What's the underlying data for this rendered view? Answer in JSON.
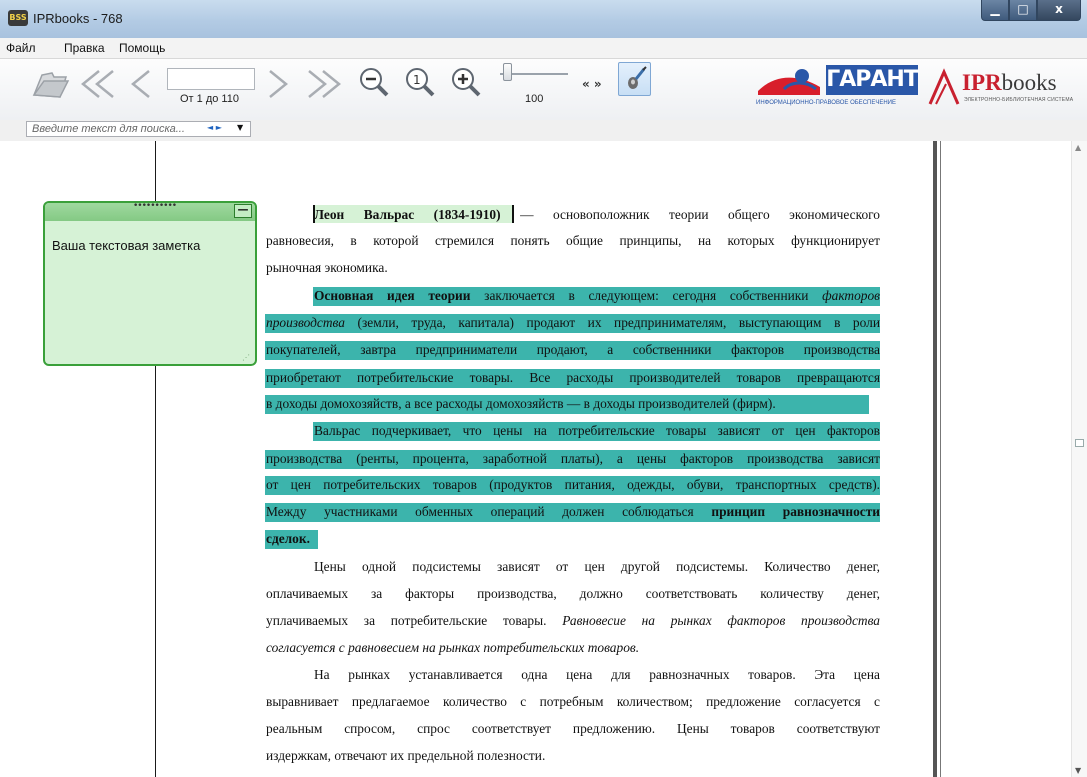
{
  "window": {
    "title": "IPRbooks - 768",
    "app_icon_text": "BSS",
    "controls": {
      "minimize": "▁",
      "maximize": "□",
      "close": "x"
    }
  },
  "menu": [
    "Файл",
    "Правка",
    "Помощь"
  ],
  "toolbar": {
    "open_icon": "folder-open-icon",
    "first_icon": "first-page-icon",
    "prev_icon": "previous-page-icon",
    "page_value": "",
    "page_caption": "От 1 до 110",
    "next_icon": "next-page-icon",
    "last_icon": "last-page-icon",
    "zoom_out_icon": "zoom-out-icon",
    "zoom_actual_icon": "zoom-actual-size-icon",
    "zoom_in_icon": "zoom-in-icon",
    "zoom_value": "100",
    "zoom_level": 0.05,
    "collapse_label": "« »",
    "note_tool_icon": "note-pen-icon"
  },
  "logos": {
    "garant_word": "ГАРАНТ",
    "garant_tag": "ИНФОРМАЦИОННО-ПРАВОВОЕ ОБЕСПЕЧЕНИЕ",
    "ipr_word": "IPR",
    "ipr_word_rest": "books",
    "ipr_tag": "ЭЛЕКТРОННО-БИБЛИОТЕЧНАЯ СИСТЕМА"
  },
  "search": {
    "placeholder": "Введите текст для поиска...",
    "nav": "◄ ►",
    "dropdown": "▼"
  },
  "note": {
    "grip": "••••••••••",
    "minimize": "—",
    "text": "Ваша текстовая заметка",
    "resize": "⋰"
  },
  "colors": {
    "highlight": "#3cb4ac",
    "note_bg": "#d6f2d6",
    "note_border": "#3aa03a"
  },
  "document": {
    "lines": [
      {
        "segs": [
          {
            "t": "Леон Вальрас (1834-1910)",
            "s": "b"
          },
          {
            "t": "  — основоположник теории общего экономического",
            "s": ""
          }
        ]
      },
      {
        "segs": [
          {
            "t": "равновесия, в которой стремился понять общие принципы, на которых функционирует",
            "s": ""
          }
        ]
      },
      {
        "segs": [
          {
            "t": "рыночная экономика.",
            "s": ""
          }
        ]
      },
      {
        "segs": [
          {
            "t": "Основная идея теории",
            "s": "b"
          },
          {
            "t": " заключается в следующем: сегодня собственники ",
            "s": ""
          },
          {
            "t": "факторов",
            "s": "i"
          }
        ]
      },
      {
        "segs": [
          {
            "t": "производства",
            "s": "i"
          },
          {
            "t": " (земли, труда, капитала) продают их предпринимателям, выступающим в роли",
            "s": ""
          }
        ]
      },
      {
        "segs": [
          {
            "t": "покупателей, завтра предприниматели продают, а собственники факторов производства",
            "s": ""
          }
        ]
      },
      {
        "segs": [
          {
            "t": "приобретают потребительские товары. Все расходы производителей товаров превращаются",
            "s": ""
          }
        ]
      },
      {
        "segs": [
          {
            "t": "в доходы домохозяйств, а все расходы домохозяйств — в доходы производителей (фирм).",
            "s": ""
          }
        ]
      },
      {
        "segs": [
          {
            "t": "Вальрас подчеркивает, что цены на потребительские товары зависят от цен факторов",
            "s": ""
          }
        ]
      },
      {
        "segs": [
          {
            "t": "производства (ренты, процента, заработной платы), а цены факторов производства зависят",
            "s": ""
          }
        ]
      },
      {
        "segs": [
          {
            "t": "от цен потребительских товаров (продуктов питания, одежды, обуви, транспортных средств).",
            "s": ""
          }
        ]
      },
      {
        "segs": [
          {
            "t": "Между участниками обменных операций должен соблюдаться ",
            "s": ""
          },
          {
            "t": "принцип равнозначности",
            "s": "b"
          }
        ]
      },
      {
        "segs": [
          {
            "t": "сделок.",
            "s": "b"
          }
        ]
      },
      {
        "segs": [
          {
            "t": "Цены одной подсистемы зависят от цен другой подсистемы. Количество денег,",
            "s": ""
          }
        ]
      },
      {
        "segs": [
          {
            "t": "оплачиваемых за факторы производства, должно соответствовать количеству денег,",
            "s": ""
          }
        ]
      },
      {
        "segs": [
          {
            "t": "уплачиваемых за потребительские товары. ",
            "s": ""
          },
          {
            "t": "Равновесие на рынках факторов производства",
            "s": "i"
          }
        ]
      },
      {
        "segs": [
          {
            "t": "согласуется с равновесием на рынках потребительских товаров.",
            "s": "i"
          }
        ]
      },
      {
        "segs": [
          {
            "t": "На рынках устанавливается одна цена для равнозначных товаров. Эта цена",
            "s": ""
          }
        ]
      },
      {
        "segs": [
          {
            "t": "выравнивает предлагаемое количество с потребным количеством; предложение согласуется с",
            "s": ""
          }
        ]
      },
      {
        "segs": [
          {
            "t": "реальным спросом, спрос соответствует предложению. Цены товаров соответствуют",
            "s": ""
          }
        ]
      },
      {
        "segs": [
          {
            "t": "издержкам, отвечают их предельной полезности.",
            "s": ""
          }
        ]
      }
    ]
  }
}
